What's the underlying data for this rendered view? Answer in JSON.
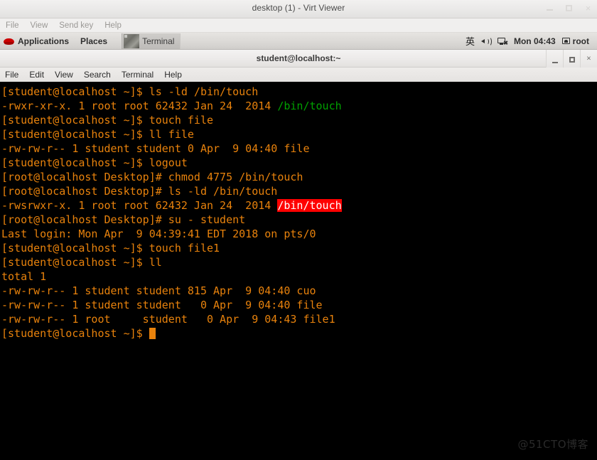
{
  "virt_viewer": {
    "title": "desktop (1) - Virt Viewer",
    "menu": [
      "File",
      "View",
      "Send key",
      "Help"
    ],
    "window_buttons": {
      "minimize": "minimize-button",
      "maximize": "maximize-button",
      "close": "×"
    }
  },
  "gnome_panel": {
    "applications_label": "Applications",
    "places_label": "Places",
    "task_label": "Terminal",
    "tray": {
      "input_method": "英",
      "clock": "Mon 04:43",
      "user": "root"
    }
  },
  "terminal_window": {
    "title": "student@localhost:~",
    "menu": [
      "File",
      "Edit",
      "View",
      "Search",
      "Terminal",
      "Help"
    ],
    "window_buttons": {
      "minimize": "minimize-button",
      "maximize": "maximize-button",
      "close": "×"
    },
    "colors": {
      "background": "#000000",
      "foreground": "#e8820c",
      "executable": "#00a000",
      "setuid_bg": "#ff0000",
      "setuid_fg": "#ffffff"
    },
    "lines": [
      {
        "id": "line-1",
        "segments": [
          {
            "text": "[student@localhost ~]$ ls -ld /bin/touch",
            "style": "normal"
          }
        ]
      },
      {
        "id": "line-2",
        "segments": [
          {
            "text": "-rwxr-xr-x. 1 root root 62432 Jan 24  2014 ",
            "style": "normal"
          },
          {
            "text": "/bin/touch",
            "style": "green"
          }
        ]
      },
      {
        "id": "line-3",
        "segments": [
          {
            "text": "[student@localhost ~]$ touch file",
            "style": "normal"
          }
        ]
      },
      {
        "id": "line-4",
        "segments": [
          {
            "text": "[student@localhost ~]$ ll file",
            "style": "normal"
          }
        ]
      },
      {
        "id": "line-5",
        "segments": [
          {
            "text": "-rw-rw-r-- 1 student student 0 Apr  9 04:40 file",
            "style": "normal"
          }
        ]
      },
      {
        "id": "line-6",
        "segments": [
          {
            "text": "[student@localhost ~]$ logout",
            "style": "normal"
          }
        ]
      },
      {
        "id": "line-7",
        "segments": [
          {
            "text": "[root@localhost Desktop]# chmod 4775 /bin/touch",
            "style": "normal"
          }
        ]
      },
      {
        "id": "line-8",
        "segments": [
          {
            "text": "[root@localhost Desktop]# ls -ld /bin/touch",
            "style": "normal"
          }
        ]
      },
      {
        "id": "line-9",
        "segments": [
          {
            "text": "-rwsrwxr-x. 1 root root 62432 Jan 24  2014 ",
            "style": "normal"
          },
          {
            "text": "/bin/touch",
            "style": "redbg"
          }
        ]
      },
      {
        "id": "line-10",
        "segments": [
          {
            "text": "[root@localhost Desktop]# su - student",
            "style": "normal"
          }
        ]
      },
      {
        "id": "line-11",
        "segments": [
          {
            "text": "Last login: Mon Apr  9 04:39:41 EDT 2018 on pts/0",
            "style": "normal"
          }
        ]
      },
      {
        "id": "line-12",
        "segments": [
          {
            "text": "[student@localhost ~]$ touch file1",
            "style": "normal"
          }
        ]
      },
      {
        "id": "line-13",
        "segments": [
          {
            "text": "[student@localhost ~]$ ll",
            "style": "normal"
          }
        ]
      },
      {
        "id": "line-14",
        "segments": [
          {
            "text": "total 1",
            "style": "normal"
          }
        ]
      },
      {
        "id": "line-15",
        "segments": [
          {
            "text": "-rw-rw-r-- 1 student student 815 Apr  9 04:40 cuo",
            "style": "normal"
          }
        ]
      },
      {
        "id": "line-16",
        "segments": [
          {
            "text": "-rw-rw-r-- 1 student student   0 Apr  9 04:40 file",
            "style": "normal"
          }
        ]
      },
      {
        "id": "line-17",
        "segments": [
          {
            "text": "-rw-rw-r-- 1 root     student   0 Apr  9 04:43 file1",
            "style": "normal"
          }
        ]
      },
      {
        "id": "line-18",
        "segments": [
          {
            "text": "[student@localhost ~]$ ",
            "style": "normal"
          },
          {
            "text": "",
            "style": "cursor"
          }
        ]
      }
    ]
  },
  "watermark": "@51CTO博客"
}
